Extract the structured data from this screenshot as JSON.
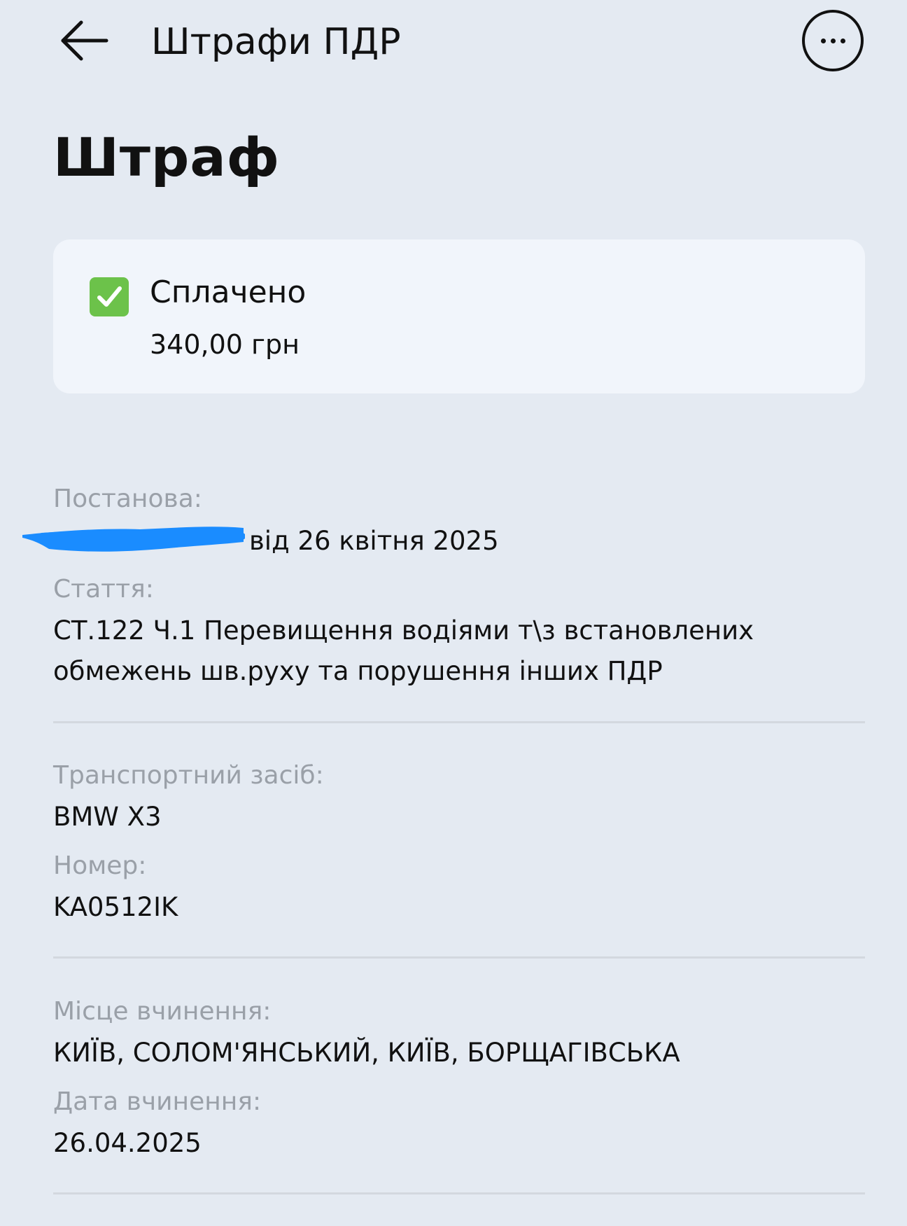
{
  "header": {
    "title": "Штрафи ПДР"
  },
  "page": {
    "title": "Штраф"
  },
  "status_card": {
    "status": "Сплачено",
    "amount": "340,00 грн",
    "icon": "check-mark-button-icon"
  },
  "details": {
    "resolution_label": "Постанова:",
    "resolution_date_text": "від 26 квітня 2025",
    "article_label": "Стаття:",
    "article_line1": "СТ.122 Ч.1 Перевищення водіями т\\з встановлених",
    "article_line2": "обмежень шв.руху та порушення інших ПДР",
    "vehicle_label": "Транспортний засіб:",
    "vehicle_value": "BMW X3",
    "number_label": "Номер:",
    "number_value": "KA0512IK",
    "place_label": "Місце вчинення:",
    "place_value": "КИЇВ, СОЛОМ'ЯНСЬКИЙ, КИЇВ, БОРЩАГІВСЬКА",
    "date_label": "Дата вчинення:",
    "date_value": "26.04.2025"
  },
  "colors": {
    "background": "#e4eaf2",
    "card": "#f1f5fb",
    "label_gray": "#9aa0a8",
    "check_green": "#6cc24a",
    "redaction_blue": "#1a8cff"
  }
}
